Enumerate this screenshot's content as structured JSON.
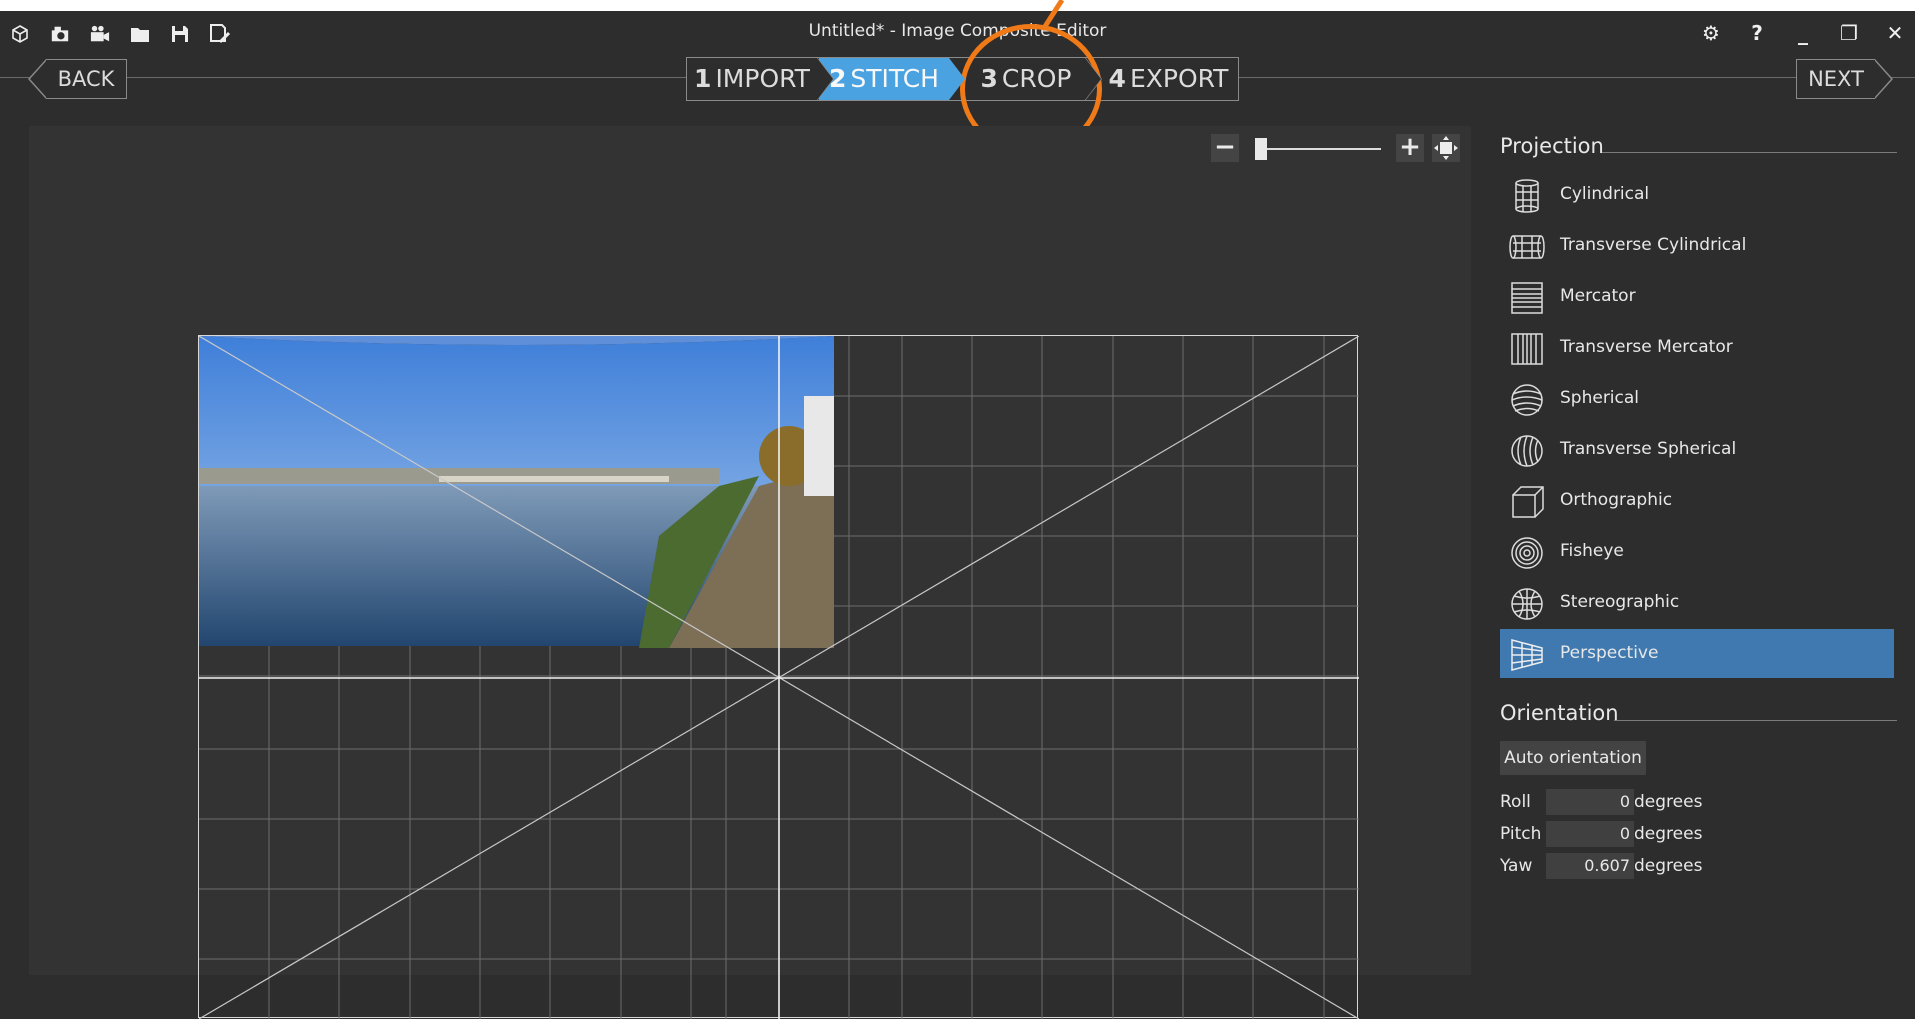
{
  "window": {
    "title": "Untitled* - Image Composite Editor",
    "quick_access_icons": [
      "new-panorama-icon",
      "camera-icon",
      "video-icon",
      "open-folder-icon",
      "save-icon",
      "save-as-icon"
    ],
    "controls": {
      "settings": "⚙",
      "help": "?",
      "minimize": "_",
      "restore": "❐",
      "close": "✕"
    }
  },
  "nav": {
    "back_label": "BACK",
    "next_label": "NEXT",
    "steps": [
      {
        "num": "1",
        "label": "IMPORT"
      },
      {
        "num": "2",
        "label": "STITCH"
      },
      {
        "num": "3",
        "label": "CROP"
      },
      {
        "num": "4",
        "label": "EXPORT"
      }
    ],
    "active_step": 2
  },
  "zoom": {
    "minus": "−",
    "plus": "+",
    "level": 0.05
  },
  "panel": {
    "projection_title": "Projection",
    "projections": [
      {
        "label": "Cylindrical",
        "icon": "cylindrical-icon"
      },
      {
        "label": "Transverse Cylindrical",
        "icon": "transverse-cylindrical-icon"
      },
      {
        "label": "Mercator",
        "icon": "mercator-icon"
      },
      {
        "label": "Transverse Mercator",
        "icon": "transverse-mercator-icon"
      },
      {
        "label": "Spherical",
        "icon": "spherical-icon"
      },
      {
        "label": "Transverse Spherical",
        "icon": "transverse-spherical-icon"
      },
      {
        "label": "Orthographic",
        "icon": "orthographic-icon"
      },
      {
        "label": "Fisheye",
        "icon": "fisheye-icon"
      },
      {
        "label": "Stereographic",
        "icon": "stereographic-icon"
      },
      {
        "label": "Perspective",
        "icon": "perspective-icon"
      }
    ],
    "selected_projection": "Perspective",
    "orientation_title": "Orientation",
    "auto_orientation_label": "Auto orientation",
    "roll": {
      "label": "Roll",
      "value": "0",
      "unit": "degrees"
    },
    "pitch": {
      "label": "Pitch",
      "value": "0",
      "unit": "degrees"
    },
    "yaw": {
      "label": "Yaw",
      "value": "0.607",
      "unit": "degrees"
    }
  },
  "colors": {
    "active_step": "#4aa3e0",
    "selected_item": "#3f79b0",
    "annotation": "#f07a17"
  }
}
